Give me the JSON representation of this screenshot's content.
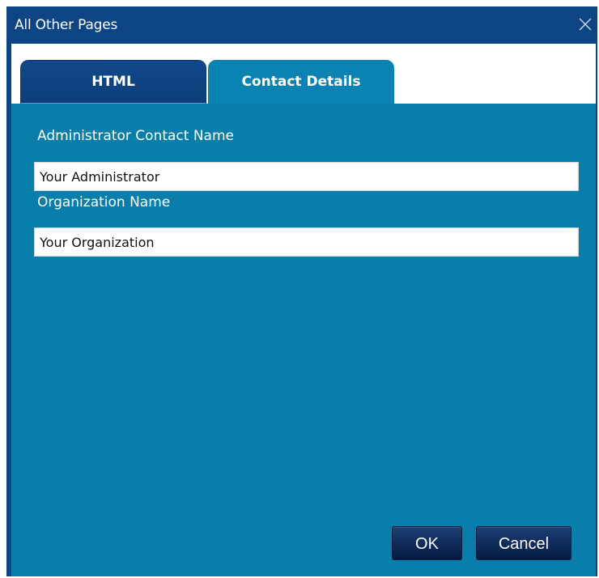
{
  "window": {
    "title": "All Other Pages",
    "close_icon": "close-icon"
  },
  "tabs": [
    {
      "label": "HTML",
      "active": false
    },
    {
      "label": "Contact Details",
      "active": true
    }
  ],
  "form": {
    "admin_contact_label": "Administrator Contact Name",
    "admin_contact_value": "Your Administrator",
    "organization_label": "Organization Name",
    "organization_value": "Your Organization"
  },
  "buttons": {
    "ok_label": "OK",
    "cancel_label": "Cancel"
  },
  "colors": {
    "titlebar": "#0d4484",
    "panel": "#0a7eaa",
    "inactive_tab": "#0b3e7a",
    "button": "#0f2c5c"
  }
}
